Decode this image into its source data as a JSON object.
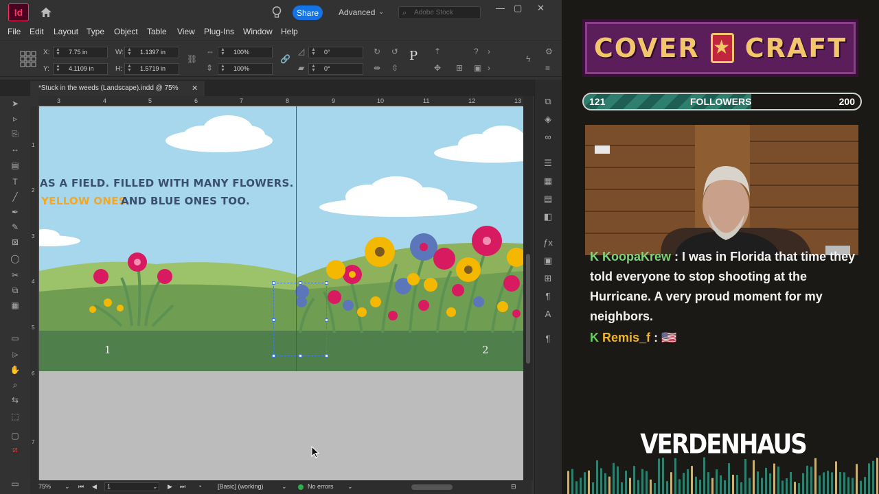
{
  "app": {
    "logo_text": "Id",
    "share_label": "Share",
    "workspace": "Advanced",
    "stock_placeholder": "Adobe Stock"
  },
  "menu": [
    "File",
    "Edit",
    "Layout",
    "Type",
    "Object",
    "Table",
    "View",
    "Plug-Ins",
    "Window",
    "Help"
  ],
  "control": {
    "x_label": "X:",
    "x_value": "7.75 in",
    "y_label": "Y:",
    "y_value": "4.1109 in",
    "w_label": "W:",
    "w_value": "1.1397 in",
    "h_label": "H:",
    "h_value": "1.5719 in",
    "scale_x": "100%",
    "scale_y": "100%",
    "rotate": "0°",
    "shear": "0°"
  },
  "document": {
    "tab_title": "*Stuck in the weeds (Landscape).indd @ 75%",
    "ruler_top": [
      "3",
      "4",
      "5",
      "6",
      "7",
      "8",
      "9",
      "10",
      "11",
      "12",
      "13"
    ],
    "ruler_left": [
      "1",
      "2",
      "3",
      "4",
      "5",
      "6",
      "7"
    ],
    "line1": "AS A FIELD. FILLED WITH MANY FLOWERS.",
    "line2_yellow": "YELLOW ONES.",
    "line2_blue": "AND BLUE ONES TOO.",
    "page_left": "1",
    "page_right": "2"
  },
  "status": {
    "zoom": "75%",
    "page": "1",
    "style": "[Basic] (working)",
    "errors": "No errors"
  },
  "stream": {
    "followers_current": "121",
    "followers_label": "FOLLOWERS",
    "followers_goal": "200",
    "followers_progress": 0.605,
    "logo_word1": "COVER",
    "logo_word2": "CRAFT",
    "chat": [
      {
        "user": "KoopaKrew",
        "message": "I was in Florida that time they told everyone to stop shooting at the Hurricane. A very proud moment for my neighbors.",
        "user_color": "#7fd37a"
      },
      {
        "user": "Remis_f",
        "message": "🇺🇸",
        "user_color": "#f0b429"
      }
    ],
    "brand": "VERDENHAUS"
  },
  "colors": {
    "accent": "#1473e6",
    "indesign": "#ff3366",
    "text_dark": "#3a4f6e",
    "text_yellow": "#f5a623",
    "sky": "#a6d7ec",
    "grass": "#4f7f4a"
  }
}
